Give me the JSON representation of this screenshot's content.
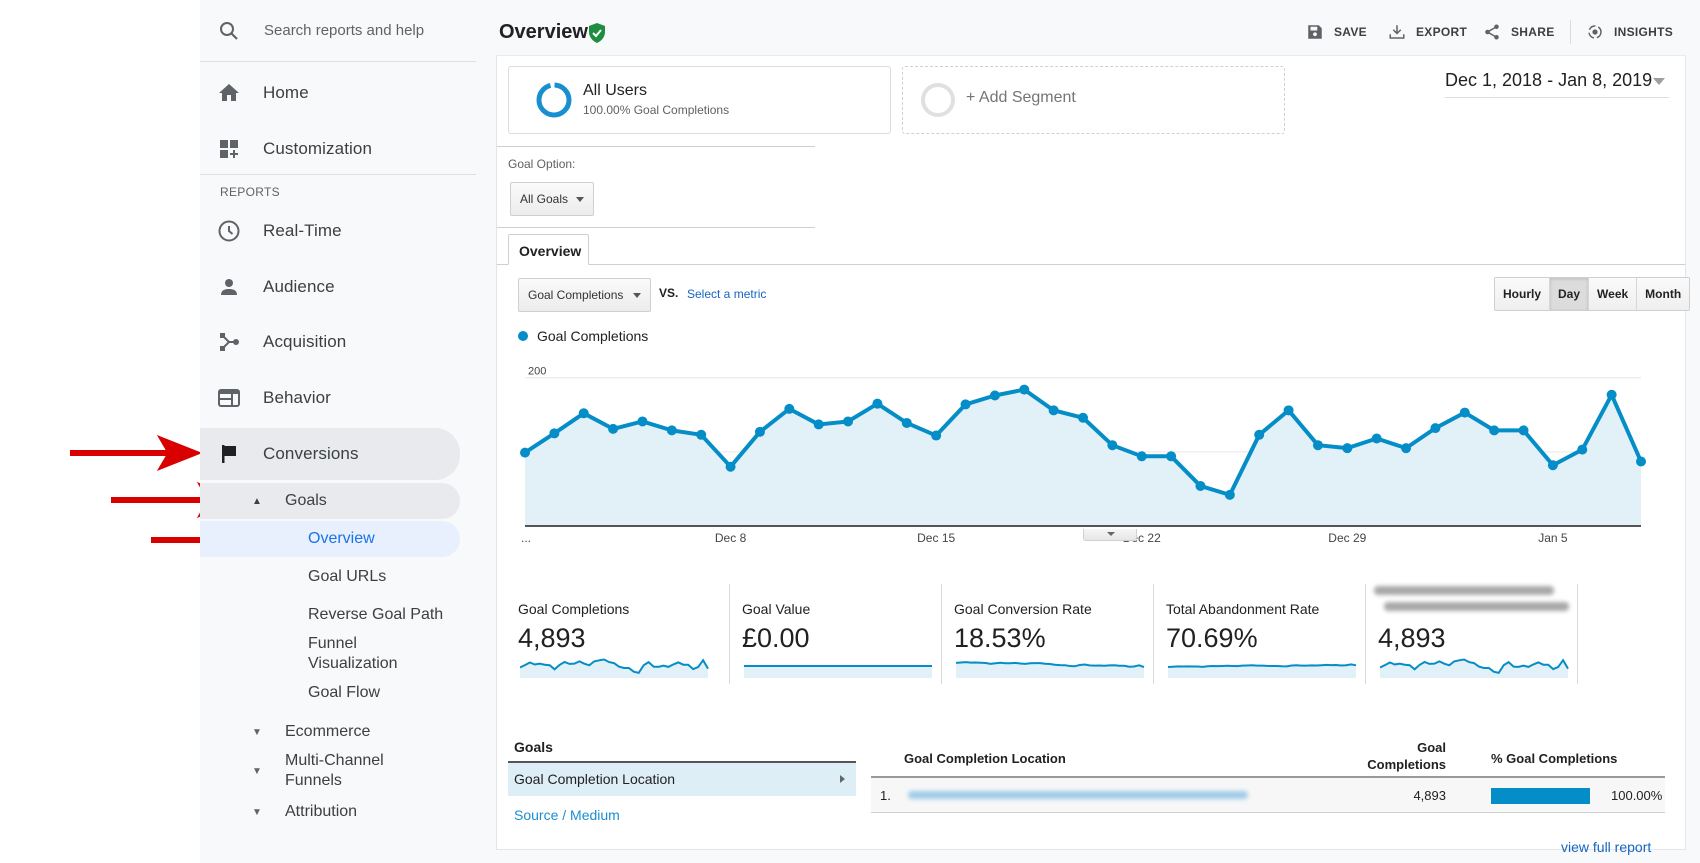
{
  "search": {
    "placeholder": "Search reports and help"
  },
  "sidebar": {
    "top_items": [
      {
        "label": "Home",
        "icon": "home-icon"
      },
      {
        "label": "Customization",
        "icon": "dashboard-icon"
      }
    ],
    "section_label": "REPORTS",
    "report_items": [
      {
        "label": "Real-Time",
        "icon": "clock-icon"
      },
      {
        "label": "Audience",
        "icon": "person-icon"
      },
      {
        "label": "Acquisition",
        "icon": "acquisition-icon"
      },
      {
        "label": "Behavior",
        "icon": "behavior-icon"
      },
      {
        "label": "Conversions",
        "icon": "flag-icon"
      }
    ],
    "goals": {
      "label": "Goals",
      "children": [
        "Overview",
        "Goal URLs",
        "Reverse Goal Path",
        "Funnel Visualization",
        "Goal Flow"
      ]
    },
    "collapsed_groups": [
      "Ecommerce",
      "Multi-Channel Funnels",
      "Attribution"
    ]
  },
  "header": {
    "title": "Overview",
    "actions": [
      {
        "label": "SAVE",
        "icon": "save-icon"
      },
      {
        "label": "EXPORT",
        "icon": "export-icon"
      },
      {
        "label": "SHARE",
        "icon": "share-icon"
      },
      {
        "label": "INSIGHTS",
        "icon": "insights-icon"
      }
    ]
  },
  "segments": {
    "all": {
      "title": "All Users",
      "subtitle": "100.00% Goal Completions"
    },
    "add_label": "+ Add Segment"
  },
  "date_range": "Dec 1, 2018 - Jan 8, 2019",
  "goal_option": {
    "label": "Goal Option:",
    "value": "All Goals"
  },
  "tabs": [
    {
      "label": "Overview",
      "active": true
    }
  ],
  "metric_selector": {
    "value": "Goal Completions",
    "vs": "VS.",
    "select_metric": "Select a metric"
  },
  "period_buttons": [
    {
      "label": "Hourly",
      "active": false
    },
    {
      "label": "Day",
      "active": true
    },
    {
      "label": "Week",
      "active": false
    },
    {
      "label": "Month",
      "active": false
    }
  ],
  "colors": {
    "series": "#058dc7",
    "area": "#e2f0f8",
    "link": "#1565c0",
    "verified": "#1e8e3e"
  },
  "chart_data": {
    "type": "area",
    "title": "",
    "legend": [
      "Goal Completions"
    ],
    "legend_position": "top-left",
    "xlabel": "",
    "ylabel": "",
    "ylim": [
      0,
      200
    ],
    "yticks": [
      100,
      200
    ],
    "grid": true,
    "xtick_labels": [
      {
        "index": 0,
        "label": "..."
      },
      {
        "index": 7,
        "label": "Dec 8"
      },
      {
        "index": 14,
        "label": "Dec 15"
      },
      {
        "index": 21,
        "label": "Dec 22"
      },
      {
        "index": 28,
        "label": "Dec 29"
      },
      {
        "index": 35,
        "label": "Jan 5"
      }
    ],
    "x": [
      "Dec 1",
      "Dec 2",
      "Dec 3",
      "Dec 4",
      "Dec 5",
      "Dec 6",
      "Dec 7",
      "Dec 8",
      "Dec 9",
      "Dec 10",
      "Dec 11",
      "Dec 12",
      "Dec 13",
      "Dec 14",
      "Dec 15",
      "Dec 16",
      "Dec 17",
      "Dec 18",
      "Dec 19",
      "Dec 20",
      "Dec 21",
      "Dec 22",
      "Dec 23",
      "Dec 24",
      "Dec 25",
      "Dec 26",
      "Dec 27",
      "Dec 28",
      "Dec 29",
      "Dec 30",
      "Dec 31",
      "Jan 1",
      "Jan 2",
      "Jan 3",
      "Jan 4",
      "Jan 5",
      "Jan 6",
      "Jan 7",
      "Jan 8"
    ],
    "series": [
      {
        "name": "Goal Completions",
        "values": [
          99,
          125,
          152,
          131,
          141,
          129,
          123,
          80,
          127,
          158,
          137,
          141,
          165,
          139,
          122,
          164,
          176,
          184,
          156,
          146,
          109,
          94,
          94,
          54,
          42,
          123,
          156,
          109,
          105,
          118,
          105,
          132,
          153,
          129,
          129,
          82,
          103,
          177,
          87
        ]
      }
    ]
  },
  "scorecards": [
    {
      "label": "Goal Completions",
      "value": "4,893",
      "trend": "variable"
    },
    {
      "label": "Goal Value",
      "value": "£0.00",
      "trend": "flat"
    },
    {
      "label": "Goal Conversion Rate",
      "value": "18.53%",
      "trend": "declining"
    },
    {
      "label": "Total Abandonment Rate",
      "value": "70.69%",
      "trend": "steady"
    },
    {
      "label": "",
      "value": "4,893",
      "trend": "variable",
      "label_redacted": true
    }
  ],
  "goals_panel": {
    "header": "Goals",
    "selected": "Goal Completion Location",
    "other": "Source / Medium"
  },
  "table": {
    "columns": [
      "Goal Completion Location",
      "Goal Completions",
      "% Goal Completions"
    ],
    "rows": [
      {
        "index": "1.",
        "location_redacted": true,
        "completions": "4,893",
        "percent": "100.00%",
        "percent_value": 100
      }
    ],
    "view_full_report": "view full report"
  }
}
